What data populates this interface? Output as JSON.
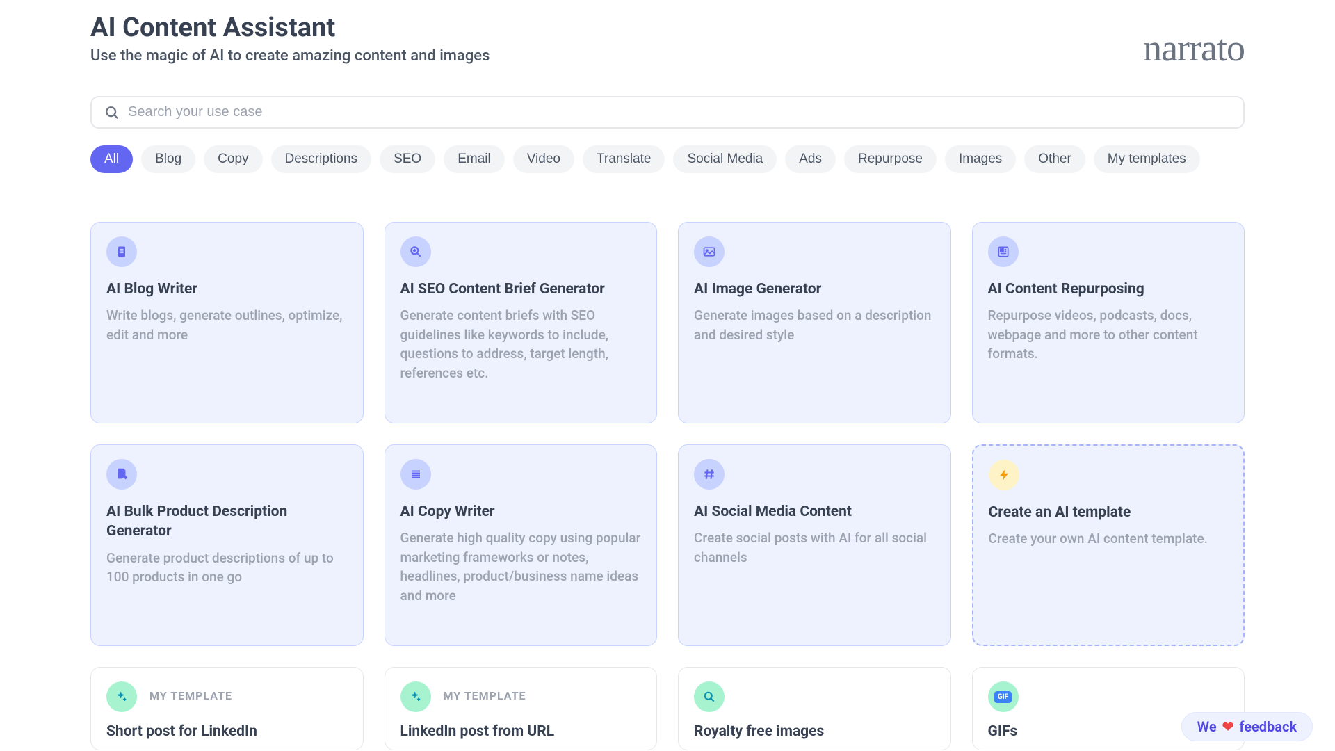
{
  "header": {
    "title": "AI Content Assistant",
    "subtitle": "Use the magic of AI to create amazing content and images",
    "logo": "narrato"
  },
  "search": {
    "placeholder": "Search your use case"
  },
  "filters": [
    {
      "label": "All",
      "active": true
    },
    {
      "label": "Blog",
      "active": false
    },
    {
      "label": "Copy",
      "active": false
    },
    {
      "label": "Descriptions",
      "active": false
    },
    {
      "label": "SEO",
      "active": false
    },
    {
      "label": "Email",
      "active": false
    },
    {
      "label": "Video",
      "active": false
    },
    {
      "label": "Translate",
      "active": false
    },
    {
      "label": "Social Media",
      "active": false
    },
    {
      "label": "Ads",
      "active": false
    },
    {
      "label": "Repurpose",
      "active": false
    },
    {
      "label": "Images",
      "active": false
    },
    {
      "label": "Other",
      "active": false
    },
    {
      "label": "My templates",
      "active": false
    }
  ],
  "cards": [
    {
      "icon": "document",
      "title": "AI Blog Writer",
      "desc": "Write blogs, generate outlines, optimize, edit and more"
    },
    {
      "icon": "magnify",
      "title": "AI SEO Content Brief Generator",
      "desc": "Generate content briefs with SEO guidelines like keywords to include, questions to address, target length, references etc."
    },
    {
      "icon": "image",
      "title": "AI Image Generator",
      "desc": "Generate images based on a description and desired style"
    },
    {
      "icon": "news",
      "title": "AI Content Repurposing",
      "desc": "Repurpose videos, podcasts, docs, webpage and more to other content formats."
    },
    {
      "icon": "doc-edit",
      "title": "AI Bulk Product Description Generator",
      "desc": "Generate product descriptions of up to 100 products in one go"
    },
    {
      "icon": "lines",
      "title": "AI Copy Writer",
      "desc": "Generate high quality copy using popular marketing frameworks or notes, headlines, product/business name ideas and more"
    },
    {
      "icon": "hash",
      "title": "AI Social Media Content",
      "desc": "Create social posts with AI for all social channels"
    },
    {
      "icon": "bolt",
      "title": "Create an AI template",
      "desc": "Create your own AI content template.",
      "dashed": true
    }
  ],
  "bottom_cards": [
    {
      "icon": "sparkle",
      "tag": "MY TEMPLATE",
      "title": "Short post for LinkedIn"
    },
    {
      "icon": "sparkle",
      "tag": "MY TEMPLATE",
      "title": "LinkedIn post from URL"
    },
    {
      "icon": "search",
      "title": "Royalty free images"
    },
    {
      "icon": "gif",
      "title": "GIFs"
    }
  ],
  "feedback": {
    "pre": "We",
    "heart": "❤️",
    "post": "feedback"
  }
}
